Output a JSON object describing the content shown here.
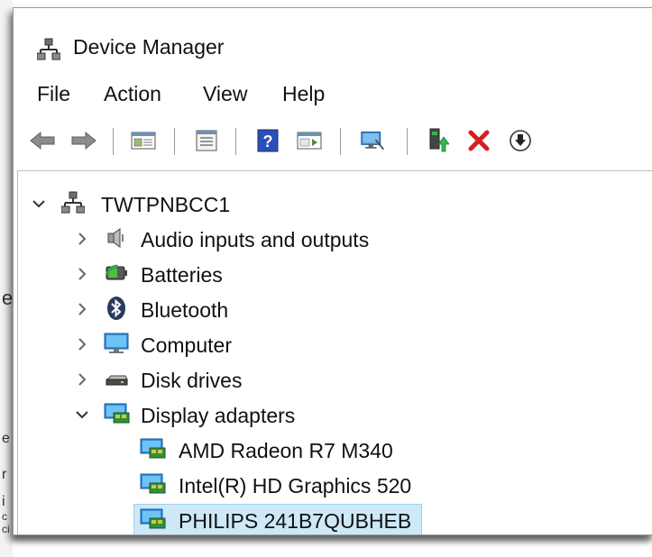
{
  "window": {
    "title": "Device Manager"
  },
  "menu": [
    "File",
    "Action",
    "View",
    "Help"
  ],
  "toolbar": {
    "buttons": [
      "back-icon",
      "forward-icon",
      "show-hide-console-tree-icon",
      "properties-icon",
      "help-icon",
      "action-pane-icon",
      "scan-hardware-icon",
      "update-driver-icon",
      "uninstall-icon",
      "disable-device-icon"
    ]
  },
  "tree": {
    "root": "TWTPNBCC1",
    "categories": [
      {
        "label": "Audio inputs and outputs",
        "icon": "speaker-icon",
        "expanded": false
      },
      {
        "label": "Batteries",
        "icon": "battery-icon",
        "expanded": false
      },
      {
        "label": "Bluetooth",
        "icon": "bluetooth-icon",
        "expanded": false
      },
      {
        "label": "Computer",
        "icon": "computer-icon",
        "expanded": false
      },
      {
        "label": "Disk drives",
        "icon": "disk-drive-icon",
        "expanded": false
      },
      {
        "label": "Display adapters",
        "icon": "display-adapter-icon",
        "expanded": true
      }
    ],
    "display_adapters": [
      {
        "label": "AMD Radeon R7 M340",
        "selected": false
      },
      {
        "label": "Intel(R) HD Graphics 520",
        "selected": false
      },
      {
        "label": "PHILIPS 241B7QUBHEB",
        "selected": true
      }
    ]
  },
  "background_fragments": [
    "e",
    "e",
    "r",
    "i",
    "c",
    "ci"
  ],
  "colors": {
    "selection": "#cde8f8",
    "uninstall_red": "#d81e1e",
    "accent_blue": "#1e6ec8"
  }
}
